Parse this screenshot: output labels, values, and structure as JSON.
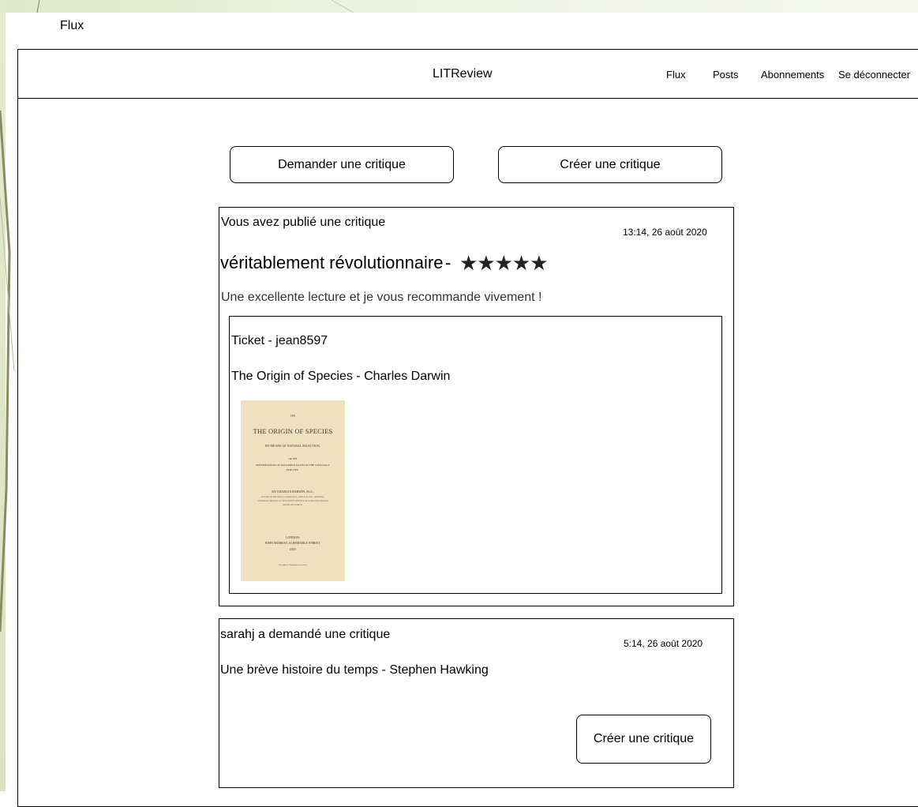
{
  "window": {
    "title": "Flux"
  },
  "header": {
    "brand": "LITReview",
    "nav": [
      "Flux",
      "Posts",
      "Abonnements",
      "Se déconnecter"
    ]
  },
  "actions": {
    "request_review": "Demander une critique",
    "create_review": "Créer une critique"
  },
  "feed": {
    "review": {
      "heading": "Vous avez publié une critique",
      "time": "13:14, 26 août 2020",
      "headline": "véritablement révolutionnaire",
      "separator": "-",
      "stars": "★★★★★",
      "rating": 5,
      "body": "Une excellente lecture et je vous recommande vivement !",
      "ticket": {
        "heading": "Ticket - jean8597",
        "book": "The Origin of Species - Charles Darwin",
        "cover": {
          "on": "ON",
          "title": "THE ORIGIN OF SPECIES",
          "line1": "BY MEANS OF NATURAL SELECTION,",
          "or": "OR THE",
          "line2": "PRESERVATION OF FAVOURED RACES IN THE STRUGGLE",
          "line3": "FOR LIFE.",
          "author": "BY CHARLES DARWIN, M.A.,",
          "credits1": "FELLOW OF THE ROYAL, GEOLOGICAL, LINNÆAN, ETC., SOCIETIES;",
          "credits2": "AUTHOR OF 'JOURNAL OF RESEARCHES DURING H. M. S. BEAGLE'S VOYAGE",
          "credits3": "ROUND THE WORLD.'",
          "city": "LONDON:",
          "publisher": "JOHN MURRAY, ALBEMARLE STREET.",
          "year": "1859.",
          "note": "The right of Translation is reserved."
        }
      }
    },
    "ticket": {
      "heading": "sarahj a demandé une critique",
      "time": "5:14, 26 août 2020",
      "book": "Une brève histoire du temps - Stephen Hawking",
      "button": "Créer une critique"
    }
  }
}
